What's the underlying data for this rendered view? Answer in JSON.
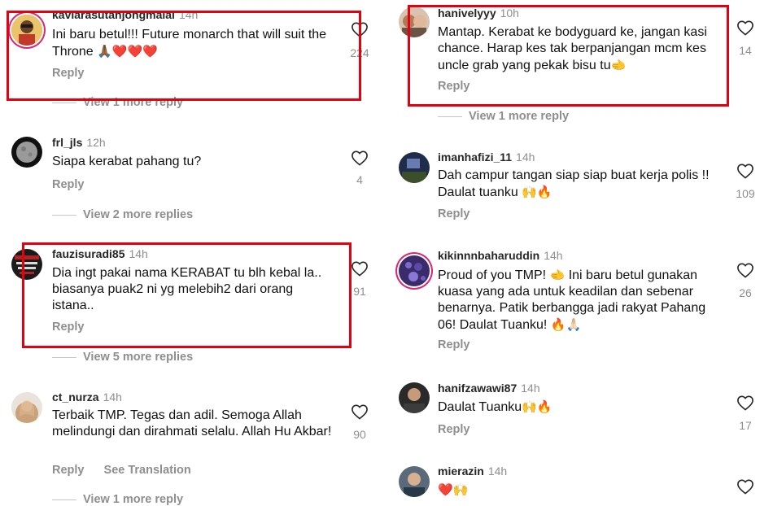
{
  "left_column": [
    {
      "username": "kavlarasutanjongmalai",
      "time": "14h",
      "text": "Ini baru betul!!! Future monarch that will suit the Throne",
      "emoji": "🙏🏾❤️❤️❤️",
      "likes": "224",
      "actions": [
        "Reply"
      ],
      "view_more": "View 1 more reply"
    },
    {
      "username": "frl_jls",
      "time": "12h",
      "text": "Siapa kerabat pahang tu?",
      "likes": "4",
      "actions": [
        "Reply"
      ],
      "view_more": "View 2 more replies"
    },
    {
      "username": "fauzisuradi85",
      "time": "14h",
      "text": "Dia ingt pakai nama KERABAT tu blh kebal la.. biasanya puak2 ni yg melebih2 dari orang istana..",
      "likes": "91",
      "actions": [
        "Reply"
      ],
      "view_more": "View 5 more replies"
    },
    {
      "username": "ct_nurza",
      "time": "14h",
      "text": "Terbaik TMP. Tegas dan adil. Semoga Allah melindungi dan dirahmati selalu. Allah Hu Akbar!",
      "likes": "90",
      "actions": [
        "Reply",
        "See Translation"
      ],
      "view_more": "View 1 more reply"
    }
  ],
  "right_column": [
    {
      "username": "hanivelyyy",
      "time": "10h",
      "text": "Mantap. Kerabat ke bodyguard ke, jangan kasi chance. Harap kes tak berpanjangan mcm kes uncle grab yang pekak bisu tu",
      "emoji": "🫲",
      "likes": "14",
      "actions": [
        "Reply"
      ],
      "view_more": "View 1 more reply"
    },
    {
      "username": "imanhafizi_11",
      "time": "14h",
      "text": "Dah campur tangan siap siap buat kerja polis !! Daulat tuanku",
      "emoji": "🙌🔥",
      "likes": "109",
      "actions": [
        "Reply"
      ]
    },
    {
      "username": "kikinnnbaharuddin",
      "time": "14h",
      "text_a": "Proud of you TMP!",
      "emoji_a": "🫲",
      "text_b": "Ini baru betul gunakan kuasa yang ada untuk keadilan dan sebenar benarnya. Patik berbangga jadi rakyat Pahang 06! Daulat Tuanku!",
      "emoji": "🔥🙏🏻",
      "likes": "26",
      "actions": [
        "Reply"
      ]
    },
    {
      "username": "hanifzawawi87",
      "time": "14h",
      "text": "Daulat Tuanku",
      "emoji": "🙌🔥",
      "likes": "17",
      "actions": [
        "Reply"
      ]
    },
    {
      "username": "mierazin",
      "time": "14h",
      "text": "",
      "emoji": "❤️🙌",
      "likes": "",
      "actions": []
    }
  ],
  "colors": {
    "highlight": "#e3000f",
    "muted": "#8e8e8e",
    "story_ring": "#d62976"
  },
  "icons": {
    "like": "heart-outline-icon"
  }
}
